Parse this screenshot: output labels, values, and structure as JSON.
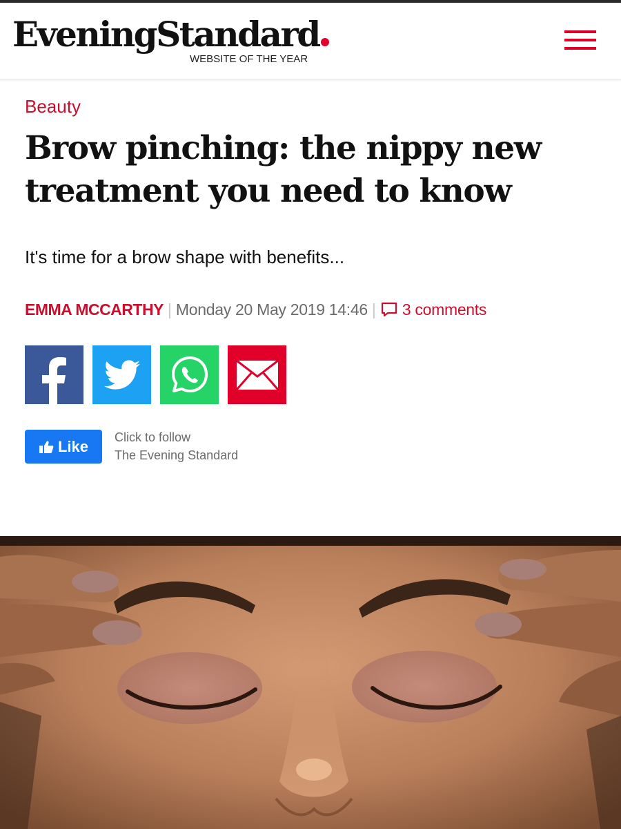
{
  "header": {
    "logo_text": "EveningStandard",
    "tagline": "WEBSITE OF THE YEAR",
    "menu_icon": "hamburger-menu-icon",
    "brand_color": "#e0002a"
  },
  "article": {
    "section": "Beauty",
    "headline": "Brow pinching: the nippy new treatment you need to know",
    "standfirst": "It's time for a brow shape with benefits...",
    "author": "EMMA MCCARTHY",
    "separator": "|",
    "date": "Monday 20 May 2019 14:46",
    "comments": "3 comments",
    "accent_color": "#c8102e"
  },
  "share": [
    {
      "network": "facebook",
      "icon": "facebook-icon",
      "color": "#3b5998"
    },
    {
      "network": "twitter",
      "icon": "twitter-icon",
      "color": "#1da1f2"
    },
    {
      "network": "whatsapp",
      "icon": "whatsapp-icon",
      "color": "#25d366"
    },
    {
      "network": "email",
      "icon": "envelope-icon",
      "color": "#e0002a"
    }
  ],
  "follow": {
    "like_label": "Like",
    "line1": "Click to follow",
    "line2": "The Evening Standard"
  }
}
